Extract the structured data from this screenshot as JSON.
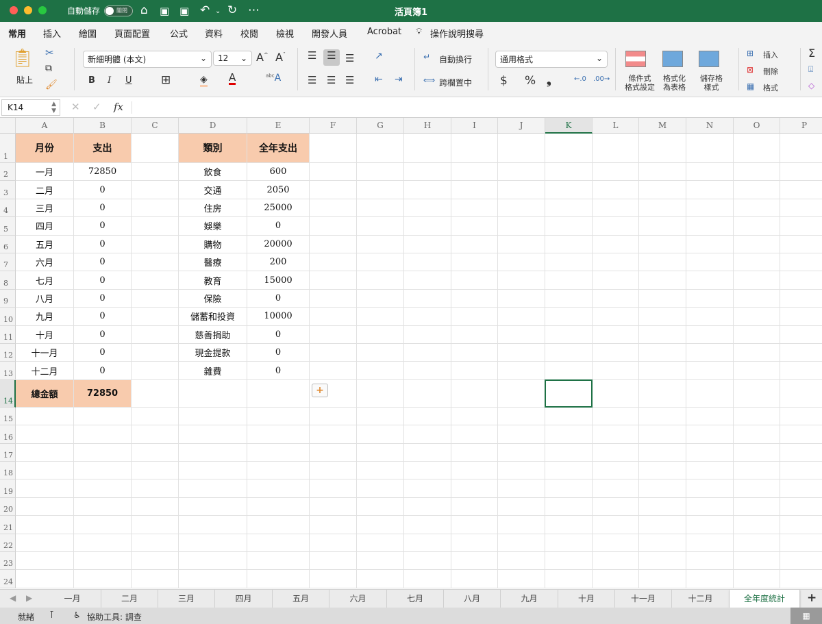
{
  "window": {
    "title": "活頁簿1",
    "autosave_label": "自動儲存",
    "autosave_state": "關閉"
  },
  "menu": {
    "items": [
      "常用",
      "插入",
      "繪圖",
      "頁面配置",
      "公式",
      "資料",
      "校閱",
      "檢視",
      "開發人員",
      "Acrobat"
    ],
    "active": 0,
    "search": "操作說明搜尋"
  },
  "ribbon": {
    "paste": "貼上",
    "font_name": "新細明體 (本文)",
    "font_size": "12",
    "bold": "B",
    "italic": "I",
    "underline": "U",
    "wrap_text": "自動換行",
    "merge_center": "跨欄置中",
    "number_format": "通用格式",
    "currency": "$",
    "percent": "%",
    "comma": "❟",
    "conditional_format": [
      "條件式",
      "格式設定"
    ],
    "format_table": [
      "格式化",
      "為表格"
    ],
    "cell_styles": [
      "儲存格",
      "樣式"
    ],
    "insert": "插入",
    "delete": "刪除",
    "format": "格式",
    "fill_color": "#f8cbad",
    "font_color": "#e00000"
  },
  "formula_bar": {
    "name_box": "K14",
    "fx": "fx",
    "value": ""
  },
  "columns": [
    "A",
    "B",
    "C",
    "D",
    "E",
    "F",
    "G",
    "H",
    "I",
    "J",
    "K",
    "L",
    "M",
    "N",
    "O",
    "P"
  ],
  "selected_cell": {
    "col": "K",
    "row": 14
  },
  "rows": [
    [
      "月份",
      "支出",
      "",
      "類別",
      "全年支出"
    ],
    [
      "一月",
      "72850",
      "",
      "飲食",
      "600"
    ],
    [
      "二月",
      "0",
      "",
      "交通",
      "2050"
    ],
    [
      "三月",
      "0",
      "",
      "住房",
      "25000"
    ],
    [
      "四月",
      "0",
      "",
      "娛樂",
      "0"
    ],
    [
      "五月",
      "0",
      "",
      "購物",
      "20000"
    ],
    [
      "六月",
      "0",
      "",
      "醫療",
      "200"
    ],
    [
      "七月",
      "0",
      "",
      "教育",
      "15000"
    ],
    [
      "八月",
      "0",
      "",
      "保險",
      "0"
    ],
    [
      "九月",
      "0",
      "",
      "儲蓄和投資",
      "10000"
    ],
    [
      "十月",
      "0",
      "",
      "慈善捐助",
      "0"
    ],
    [
      "十一月",
      "0",
      "",
      "現金提款",
      "0"
    ],
    [
      "十二月",
      "0",
      "",
      "雜費",
      "0"
    ],
    [
      "總金額",
      "72850",
      "",
      "",
      ""
    ]
  ],
  "row_count": 24,
  "header_fill": "#f8cbad",
  "sheets": [
    "一月",
    "二月",
    "三月",
    "四月",
    "五月",
    "六月",
    "七月",
    "八月",
    "九月",
    "十月",
    "十一月",
    "十二月",
    "全年度統計"
  ],
  "active_sheet": "全年度統計",
  "status": {
    "ready": "就緒",
    "accessibility": "協助工具: 調查"
  }
}
